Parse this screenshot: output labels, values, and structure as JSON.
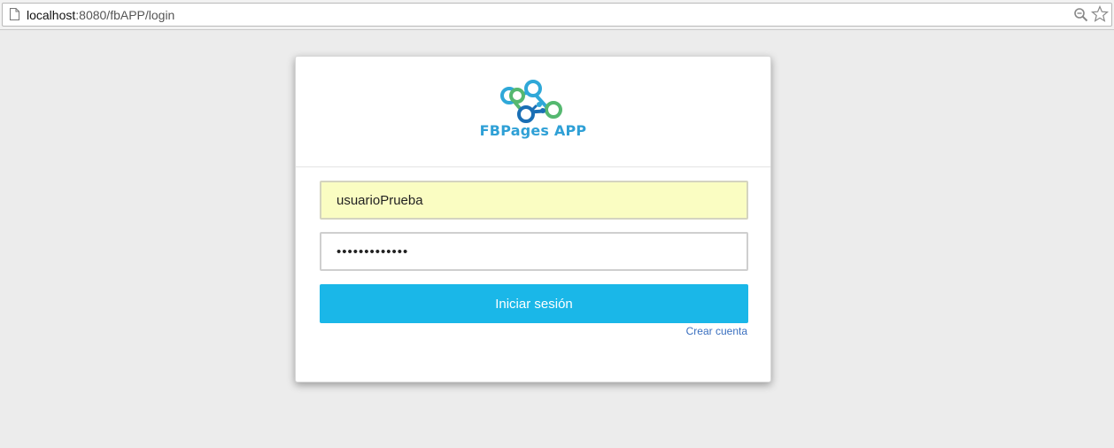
{
  "browser": {
    "url_host": "localhost",
    "url_rest": ":8080/fbAPP/login"
  },
  "login": {
    "logo_text": "FBPages APP",
    "username_value": "usuarioPrueba",
    "password_value": "•••••••••••••",
    "submit_label": "Iniciar sesión",
    "create_account_label": "Crear cuenta"
  },
  "colors": {
    "primary_button": "#1ab7e8",
    "autofill_bg": "#fafdc2",
    "logo_text": "#2fa0d6",
    "link": "#3a6fbf"
  }
}
